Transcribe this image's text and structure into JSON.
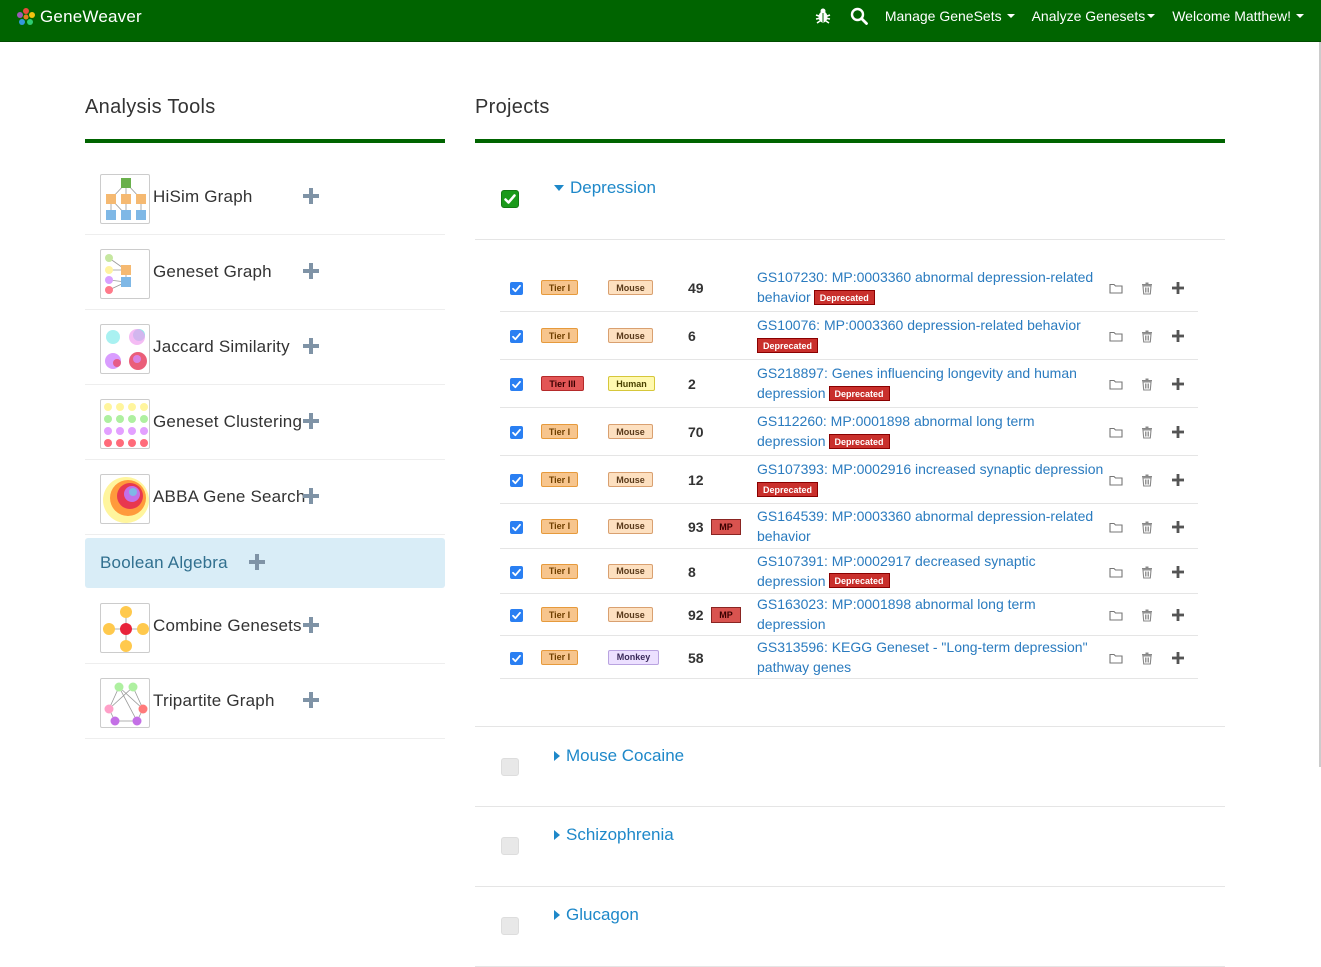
{
  "navbar": {
    "brand": "GeneWeaver",
    "menu": [
      "Manage GeneSets",
      "Analyze Genesets",
      "Welcome Matthew!"
    ],
    "icons": [
      "bug-icon",
      "search-icon"
    ],
    "bg_color": "#006400"
  },
  "tools": {
    "title": "Analysis Tools",
    "items": [
      {
        "label": "HiSim Graph",
        "icon": "hisim-graph-thumb"
      },
      {
        "label": "Geneset Graph",
        "icon": "geneset-graph-thumb"
      },
      {
        "label": "Jaccard Similarity",
        "icon": "jaccard-thumb"
      },
      {
        "label": "Geneset Clustering",
        "icon": "clustering-thumb"
      },
      {
        "label": "ABBA Gene Search",
        "icon": "abba-thumb"
      },
      {
        "label": "Boolean Algebra",
        "icon": "none",
        "active": true
      },
      {
        "label": "Combine Genesets",
        "icon": "combine-thumb"
      },
      {
        "label": "Tripartite Graph",
        "icon": "tripartite-thumb"
      }
    ]
  },
  "projects": {
    "title": "Projects",
    "list": [
      {
        "name": "Depression",
        "expanded": true,
        "checked": true
      },
      {
        "name": "Mouse Cocaine",
        "expanded": false,
        "checked": false
      },
      {
        "name": "Schizophrenia",
        "expanded": false,
        "checked": false
      },
      {
        "name": "Glucagon",
        "expanded": false,
        "checked": false
      }
    ],
    "genesets": [
      {
        "tier": "Tier I",
        "species": "Mouse",
        "count": "49",
        "mp": false,
        "line1": "GS107230: MP:0003360 abnormal depression-related",
        "line2": "behavior",
        "deprecated": true
      },
      {
        "tier": "Tier I",
        "species": "Mouse",
        "count": "6",
        "mp": false,
        "line1": "GS10076: MP:0003360 depression-related behavior",
        "line2": "",
        "deprecated": true
      },
      {
        "tier": "Tier III",
        "species": "Human",
        "count": "2",
        "mp": false,
        "line1": "GS218897: Genes influencing longevity and human",
        "line2": "depression",
        "deprecated": true
      },
      {
        "tier": "Tier I",
        "species": "Mouse",
        "count": "70",
        "mp": false,
        "line1": "GS112260: MP:0001898 abnormal long term",
        "line2": "depression",
        "deprecated": true
      },
      {
        "tier": "Tier I",
        "species": "Mouse",
        "count": "12",
        "mp": false,
        "line1": "GS107393: MP:0002916 increased synaptic depression",
        "line2": "",
        "deprecated": true
      },
      {
        "tier": "Tier I",
        "species": "Mouse",
        "count": "93",
        "mp": true,
        "line1": "GS164539: MP:0003360 abnormal depression-related",
        "line2": "behavior",
        "deprecated": false
      },
      {
        "tier": "Tier I",
        "species": "Mouse",
        "count": "8",
        "mp": false,
        "line1": "GS107391: MP:0002917 decreased synaptic",
        "line2": "depression",
        "deprecated": true
      },
      {
        "tier": "Tier I",
        "species": "Mouse",
        "count": "92",
        "mp": true,
        "line1": "GS163023: MP:0001898 abnormal long term",
        "line2": "depression",
        "deprecated": false
      },
      {
        "tier": "Tier I",
        "species": "Monkey",
        "count": "58",
        "mp": false,
        "line1": "GS313596: KEGG Geneset - \"Long-term depression\"",
        "line2": "pathway genes",
        "deprecated": false
      }
    ],
    "deprecated_label": "Deprecated",
    "mp_label": "MP",
    "row_actions": [
      "folder-icon",
      "trash-icon",
      "plus-icon"
    ]
  },
  "colors": {
    "link": "#2a7bbf",
    "deprecated": "#c9302c",
    "active_tool_bg": "#d9edf7"
  }
}
